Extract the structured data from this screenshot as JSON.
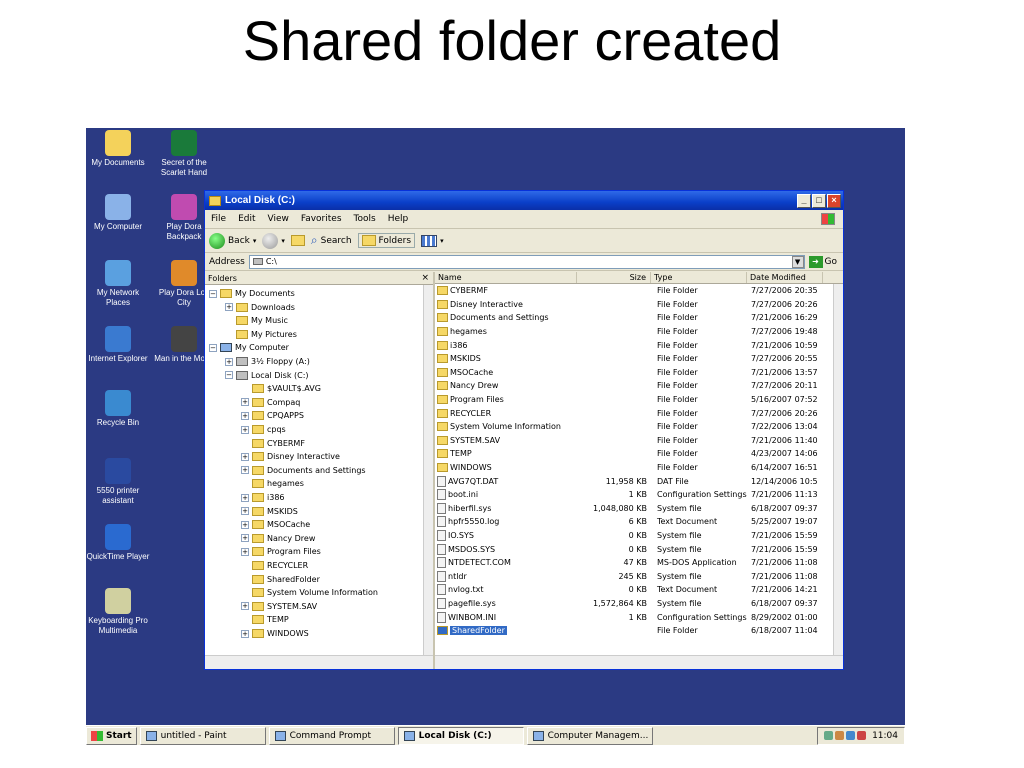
{
  "slide": {
    "title": "Shared folder created"
  },
  "desktop_icons": [
    {
      "label": "My Documents",
      "color": "#f4d25b"
    },
    {
      "label": "Secret of the Scarlet Hand",
      "color": "#1a7a3a"
    },
    {
      "label": "My Computer",
      "color": "#8ab2e8"
    },
    {
      "label": "Play Dora Backpack",
      "color": "#c04bb0"
    },
    {
      "label": "My Network Places",
      "color": "#5aa0e0"
    },
    {
      "label": "Play Dora Los City",
      "color": "#e08a2a"
    },
    {
      "label": "Internet Explorer",
      "color": "#3a7ad0"
    },
    {
      "label": "Man in the Moon",
      "color": "#444444"
    },
    {
      "label": "Recycle Bin",
      "color": "#3a8ad0"
    },
    {
      "label": "5550 printer assistant",
      "color": "#2a4aa0"
    },
    {
      "label": "QuickTime Player",
      "color": "#2a6ad0"
    },
    {
      "label": "Keyboarding Pro Multimedia",
      "color": "#d0d0a0"
    }
  ],
  "window": {
    "title": "Local Disk (C:)",
    "buttons": {
      "minimize": "_",
      "maximize": "□",
      "close": "×"
    },
    "menu": [
      "File",
      "Edit",
      "View",
      "Favorites",
      "Tools",
      "Help"
    ],
    "toolbar": {
      "back": "Back",
      "search": "Search",
      "folders": "Folders"
    },
    "address": {
      "label": "Address",
      "value": "C:\\",
      "go": "Go"
    },
    "tree_header": "Folders",
    "tree_close": "×",
    "tree": [
      {
        "label": "My Documents",
        "pm": "−",
        "icon": "folder"
      },
      {
        "label": "Downloads",
        "pm": "+",
        "icon": "folder"
      },
      {
        "label": "My Music",
        "pm": "",
        "icon": "folder"
      },
      {
        "label": "My Pictures",
        "pm": "",
        "icon": "folder"
      },
      {
        "label": "My Computer",
        "pm": "−",
        "icon": "pc"
      },
      {
        "label": "3½ Floppy (A:)",
        "pm": "+",
        "icon": "drive"
      },
      {
        "label": "Local Disk (C:)",
        "pm": "−",
        "icon": "drive"
      },
      {
        "label": "$VAULT$.AVG",
        "pm": "",
        "icon": "folder"
      },
      {
        "label": "Compaq",
        "pm": "+",
        "icon": "folder"
      },
      {
        "label": "CPQAPPS",
        "pm": "+",
        "icon": "folder"
      },
      {
        "label": "cpqs",
        "pm": "+",
        "icon": "folder"
      },
      {
        "label": "CYBERMF",
        "pm": "",
        "icon": "folder"
      },
      {
        "label": "Disney Interactive",
        "pm": "+",
        "icon": "folder"
      },
      {
        "label": "Documents and Settings",
        "pm": "+",
        "icon": "folder"
      },
      {
        "label": "hegames",
        "pm": "",
        "icon": "folder"
      },
      {
        "label": "i386",
        "pm": "+",
        "icon": "folder"
      },
      {
        "label": "MSKIDS",
        "pm": "+",
        "icon": "folder"
      },
      {
        "label": "MSOCache",
        "pm": "+",
        "icon": "folder"
      },
      {
        "label": "Nancy Drew",
        "pm": "+",
        "icon": "folder"
      },
      {
        "label": "Program Files",
        "pm": "+",
        "icon": "folder"
      },
      {
        "label": "RECYCLER",
        "pm": "",
        "icon": "folder"
      },
      {
        "label": "SharedFolder",
        "pm": "",
        "icon": "folder"
      },
      {
        "label": "System Volume Information",
        "pm": "",
        "icon": "folder"
      },
      {
        "label": "SYSTEM.SAV",
        "pm": "+",
        "icon": "folder"
      },
      {
        "label": "TEMP",
        "pm": "",
        "icon": "folder"
      },
      {
        "label": "WINDOWS",
        "pm": "+",
        "icon": "folder"
      }
    ],
    "columns": {
      "name": "Name",
      "size": "Size",
      "type": "Type",
      "date": "Date Modified"
    },
    "files": [
      {
        "name": "CYBERMF",
        "size": "",
        "type": "File Folder",
        "date": "7/27/2006 20:35",
        "icon": "folder"
      },
      {
        "name": "Disney Interactive",
        "size": "",
        "type": "File Folder",
        "date": "7/27/2006 20:26",
        "icon": "folder"
      },
      {
        "name": "Documents and Settings",
        "size": "",
        "type": "File Folder",
        "date": "7/21/2006 16:29",
        "icon": "folder"
      },
      {
        "name": "hegames",
        "size": "",
        "type": "File Folder",
        "date": "7/27/2006 19:48",
        "icon": "folder"
      },
      {
        "name": "i386",
        "size": "",
        "type": "File Folder",
        "date": "7/21/2006 10:59",
        "icon": "folder"
      },
      {
        "name": "MSKIDS",
        "size": "",
        "type": "File Folder",
        "date": "7/27/2006 20:55",
        "icon": "folder"
      },
      {
        "name": "MSOCache",
        "size": "",
        "type": "File Folder",
        "date": "7/21/2006 13:57",
        "icon": "folder"
      },
      {
        "name": "Nancy Drew",
        "size": "",
        "type": "File Folder",
        "date": "7/27/2006 20:11",
        "icon": "folder"
      },
      {
        "name": "Program Files",
        "size": "",
        "type": "File Folder",
        "date": "5/16/2007 07:52",
        "icon": "folder"
      },
      {
        "name": "RECYCLER",
        "size": "",
        "type": "File Folder",
        "date": "7/27/2006 20:26",
        "icon": "folder"
      },
      {
        "name": "System Volume Information",
        "size": "",
        "type": "File Folder",
        "date": "7/22/2006 13:04",
        "icon": "folder"
      },
      {
        "name": "SYSTEM.SAV",
        "size": "",
        "type": "File Folder",
        "date": "7/21/2006 11:40",
        "icon": "folder"
      },
      {
        "name": "TEMP",
        "size": "",
        "type": "File Folder",
        "date": "4/23/2007 14:06",
        "icon": "folder"
      },
      {
        "name": "WINDOWS",
        "size": "",
        "type": "File Folder",
        "date": "6/14/2007 16:51",
        "icon": "folder"
      },
      {
        "name": "AVG7QT.DAT",
        "size": "11,958 KB",
        "type": "DAT File",
        "date": "12/14/2006 10:5",
        "icon": "file"
      },
      {
        "name": "boot.ini",
        "size": "1 KB",
        "type": "Configuration Settings",
        "date": "7/21/2006 11:13",
        "icon": "file"
      },
      {
        "name": "hiberfil.sys",
        "size": "1,048,080 KB",
        "type": "System file",
        "date": "6/18/2007 09:37",
        "icon": "file"
      },
      {
        "name": "hpfr5550.log",
        "size": "6 KB",
        "type": "Text Document",
        "date": "5/25/2007 19:07",
        "icon": "file"
      },
      {
        "name": "IO.SYS",
        "size": "0 KB",
        "type": "System file",
        "date": "7/21/2006 15:59",
        "icon": "file"
      },
      {
        "name": "MSDOS.SYS",
        "size": "0 KB",
        "type": "System file",
        "date": "7/21/2006 15:59",
        "icon": "file"
      },
      {
        "name": "NTDETECT.COM",
        "size": "47 KB",
        "type": "MS-DOS Application",
        "date": "7/21/2006 11:08",
        "icon": "file"
      },
      {
        "name": "ntldr",
        "size": "245 KB",
        "type": "System file",
        "date": "7/21/2006 11:08",
        "icon": "file"
      },
      {
        "name": "nvlog.txt",
        "size": "0 KB",
        "type": "Text Document",
        "date": "7/21/2006 14:21",
        "icon": "file"
      },
      {
        "name": "pagefile.sys",
        "size": "1,572,864 KB",
        "type": "System file",
        "date": "6/18/2007 09:37",
        "icon": "file"
      },
      {
        "name": "WINBOM.INI",
        "size": "1 KB",
        "type": "Configuration Settings",
        "date": "8/29/2002 01:00",
        "icon": "file"
      },
      {
        "name": "SharedFolder",
        "size": "",
        "type": "File Folder",
        "date": "6/18/2007 11:04",
        "icon": "folder",
        "selected": true
      }
    ]
  },
  "taskbar": {
    "start": "Start",
    "tasks": [
      {
        "label": "untitled - Paint",
        "active": false
      },
      {
        "label": "Command Prompt",
        "active": false
      },
      {
        "label": "Local Disk (C:)",
        "active": true
      },
      {
        "label": "Computer Managem...",
        "active": false
      }
    ],
    "clock": "11:04"
  }
}
